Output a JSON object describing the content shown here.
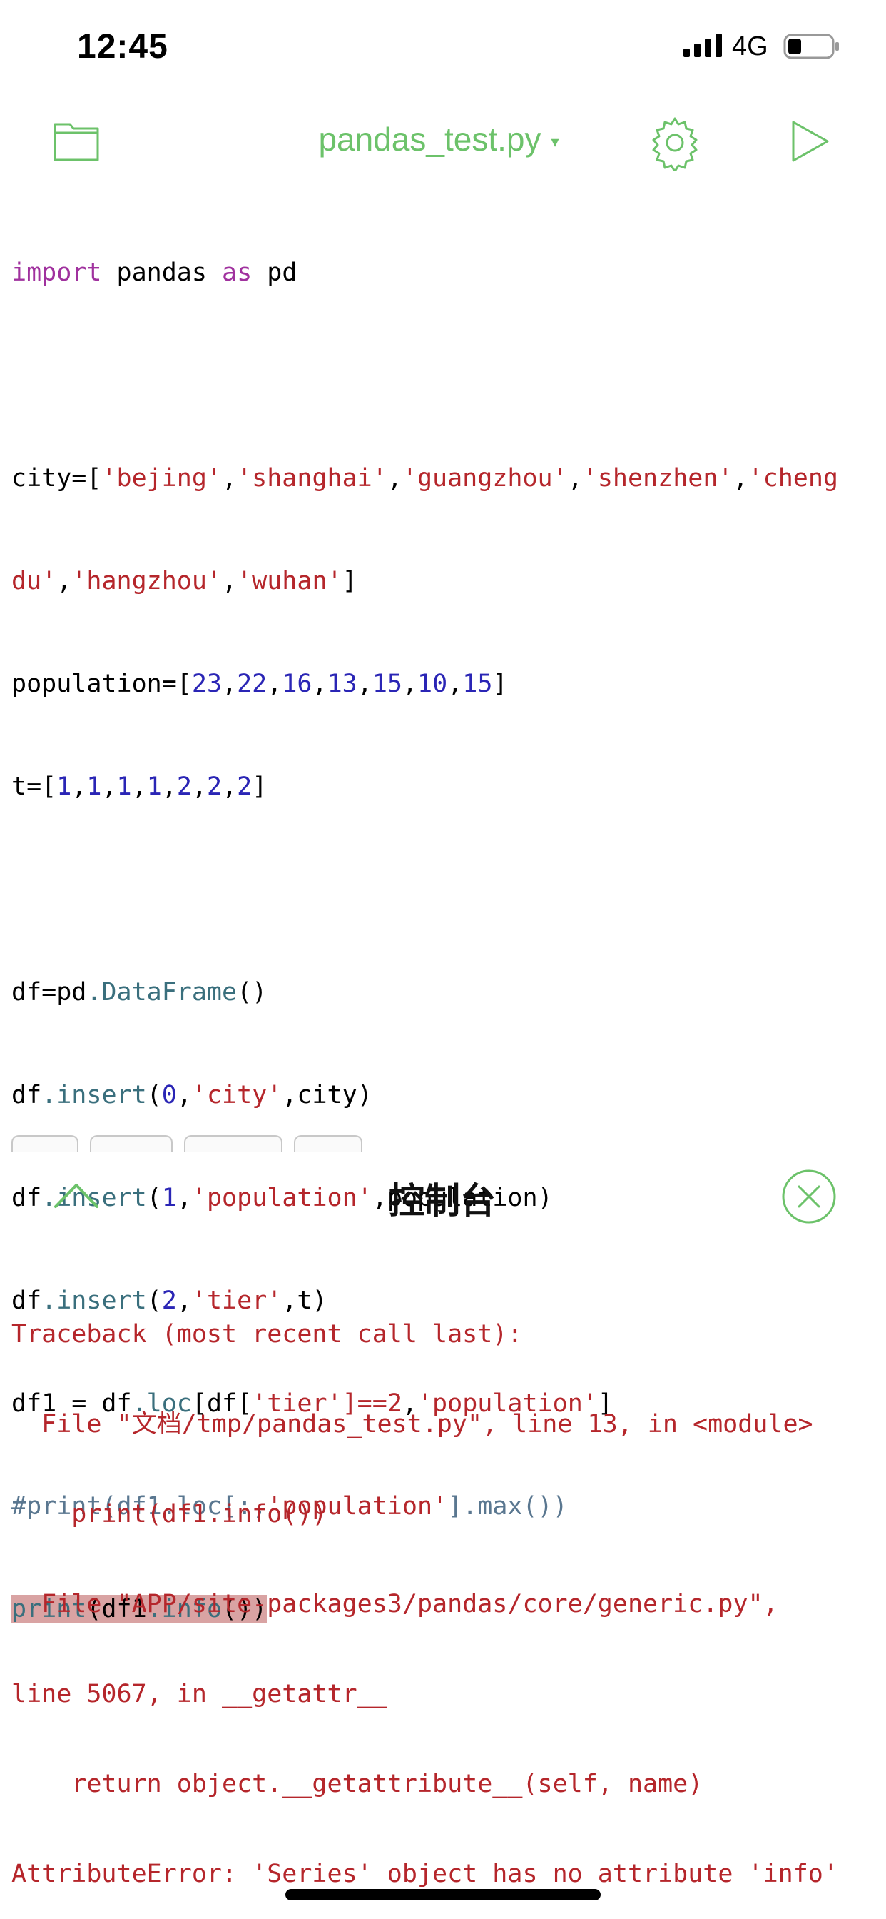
{
  "status": {
    "time": "12:45",
    "network": "4G",
    "battery_icon": "battery-low-icon",
    "signal_icon": "signal-bars-icon"
  },
  "toolbar": {
    "file_name": "pandas_test.py",
    "caret": "▾",
    "folder_icon": "folder-icon",
    "settings_icon": "gear-icon",
    "run_icon": "play-icon"
  },
  "colors": {
    "accent": "#6cc26a",
    "keyword": "#a0319e",
    "string": "#b5262b",
    "number": "#2a25b5",
    "method": "#3a6f7d",
    "comment": "#5a7790",
    "highlight": "#d9a3a3",
    "error": "#b5262b"
  },
  "code": {
    "l1": {
      "a": "import",
      "b": " pandas ",
      "c": "as",
      "d": " pd"
    },
    "l3": {
      "a": "city=[",
      "s1": "'bejing'",
      "s2": "'shanghai'",
      "s3": "'guangzhou'",
      "s4": "'shenzhen'",
      "s5a": "'cheng",
      "comma": ","
    },
    "l4": {
      "s5b": "du'",
      "s6": "'hangzhou'",
      "s7": "'wuhan'",
      "close": "]"
    },
    "l5": {
      "a": "population=[",
      "nums": [
        "23",
        "22",
        "16",
        "13",
        "15",
        "10",
        "15"
      ],
      "close": "]"
    },
    "l6": {
      "a": "t=[",
      "nums": [
        "1",
        "1",
        "1",
        "1",
        "2",
        "2",
        "2"
      ],
      "close": "]"
    },
    "l8": {
      "a": "df=pd",
      "b": ".DataFrame",
      "c": "()"
    },
    "l9": {
      "a": "df",
      "b": ".insert",
      "c": "(",
      "n": "0",
      "d": ",",
      "s": "'city'",
      "e": ",city)"
    },
    "l10": {
      "a": "df",
      "b": ".insert",
      "c": "(",
      "n": "1",
      "d": ",",
      "s": "'population'",
      "e": ",population)"
    },
    "l11": {
      "a": "df",
      "b": ".insert",
      "c": "(",
      "n": "2",
      "d": ",",
      "s": "'tier'",
      "e": ",t)"
    },
    "l12": {
      "a": "df1 = df",
      "b": ".loc",
      "c": "[df[",
      "s1": "'tier'",
      "op": "]==2",
      "d": ",",
      "s2": "'population'",
      "e": "]"
    },
    "l13": {
      "a": "#print(df1.loc[:,",
      "s": "'population'",
      "b": "].max())"
    },
    "l14": {
      "a": "print",
      "b": "(df1",
      "c": ".info",
      "d": "())"
    }
  },
  "console": {
    "title": "控制台",
    "collapse_icon": "chevron-up-icon",
    "close_icon": "close-circle-icon",
    "lines": [
      "Traceback (most recent call last):",
      "  File \"文档/tmp/pandas_test.py\", line 13, in <module>",
      "    print(df1.info())",
      "  File \"APP/site-packages3/pandas/core/generic.py\",",
      "line 5067, in __getattr__",
      "    return object.__getattribute__(self, name)",
      "AttributeError: 'Series' object has no attribute 'info'"
    ]
  }
}
